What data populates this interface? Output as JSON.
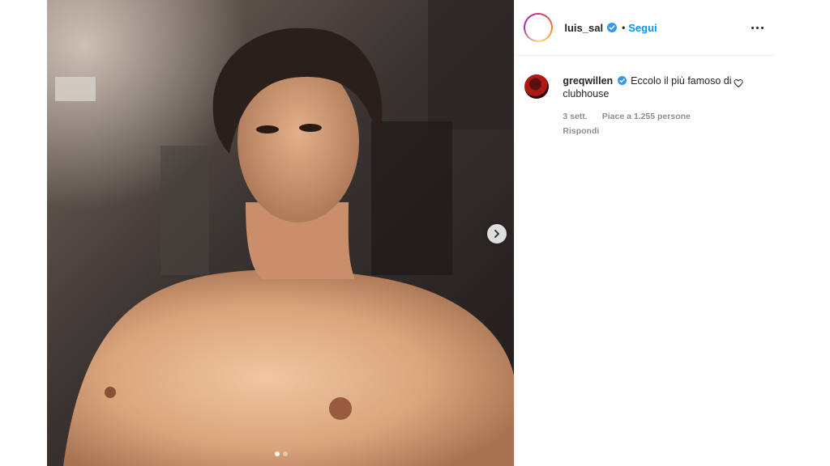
{
  "post": {
    "author": {
      "username": "luis_sal",
      "verified": true,
      "separator": "•",
      "follow_label": "Segui"
    },
    "media": {
      "description_icon": "photo",
      "carousel": {
        "count": 2,
        "active_index": 0
      },
      "next_icon": "chevron-right-icon"
    },
    "more_icon": "more-horizontal-icon"
  },
  "comment": {
    "username": "greqwillen",
    "verified": true,
    "text": "Eccolo il più famoso di clubhouse",
    "time": "3 sett.",
    "likes": "Piace a 1.255 persone",
    "reply_label": "Rispondi",
    "like_icon": "heart-icon"
  },
  "colors": {
    "link": "#0095f6",
    "verified": "#3897f0",
    "muted": "#8e8e8e",
    "text": "#262626"
  }
}
